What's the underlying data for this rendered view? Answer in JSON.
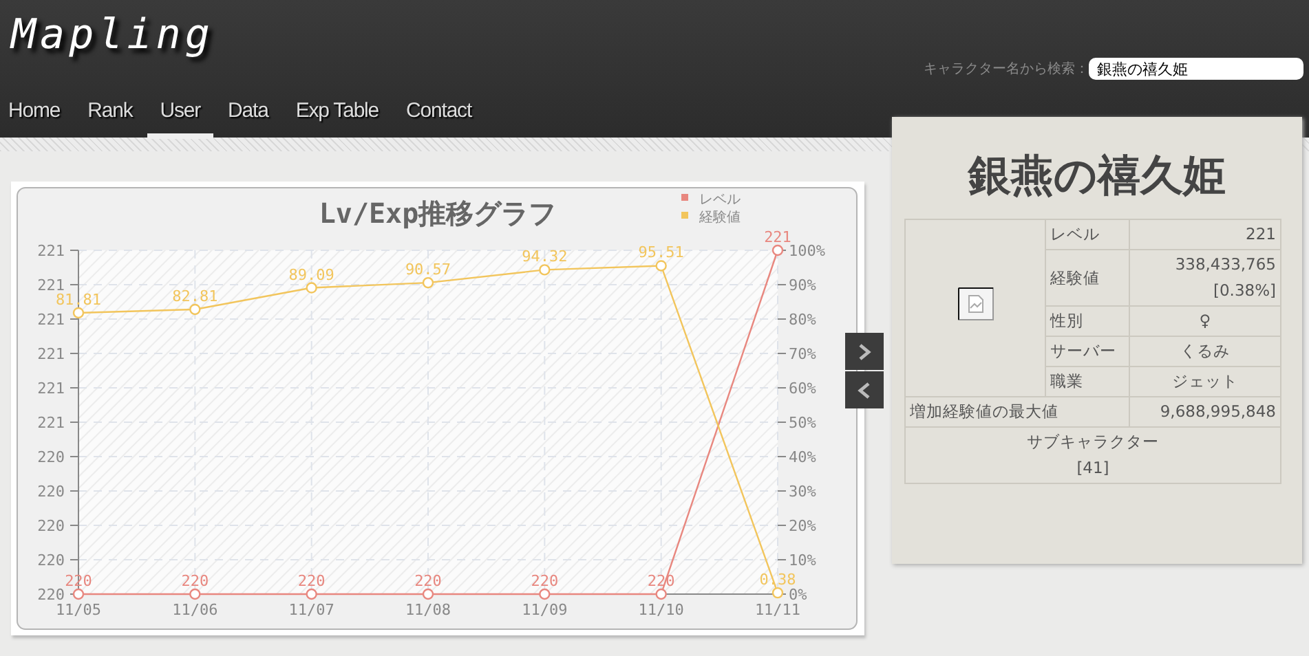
{
  "site": {
    "logo": "Mapling"
  },
  "nav": [
    {
      "label": "Home",
      "selected": false
    },
    {
      "label": "Rank",
      "selected": false
    },
    {
      "label": "User",
      "selected": true
    },
    {
      "label": "Data",
      "selected": false
    },
    {
      "label": "Exp Table",
      "selected": false
    },
    {
      "label": "Contact",
      "selected": false
    }
  ],
  "search": {
    "label": "キャラクター名から検索：",
    "value": "銀燕の禧久姫"
  },
  "chart_panel": {
    "chart_data": {
      "type": "line",
      "title": "Lv/Exp推移グラフ",
      "categories": [
        "11/05",
        "11/06",
        "11/07",
        "11/08",
        "11/09",
        "11/10",
        "11/11"
      ],
      "series": [
        {
          "name": "レベル",
          "color": "#e8877f",
          "axis": "y2",
          "marker": "circle",
          "values": [
            220,
            220,
            220,
            220,
            220,
            220,
            221
          ]
        },
        {
          "name": "経験値",
          "color": "#f2c55c",
          "marker": "circle",
          "values": [
            81.81,
            82.81,
            89.09,
            90.57,
            94.32,
            95.51,
            0.38
          ]
        }
      ],
      "ylim": [
        0,
        100
      ],
      "yticks": [
        {
          "value": 0,
          "label": "0%"
        },
        {
          "value": 10,
          "label": "10%"
        },
        {
          "value": 20,
          "label": "20%"
        },
        {
          "value": 30,
          "label": "30%"
        },
        {
          "value": 40,
          "label": "40%"
        },
        {
          "value": 50,
          "label": "50%"
        },
        {
          "value": 60,
          "label": "60%"
        },
        {
          "value": 70,
          "label": "70%"
        },
        {
          "value": 80,
          "label": "80%"
        },
        {
          "value": 90,
          "label": "90%"
        },
        {
          "value": 100,
          "label": "100%"
        }
      ],
      "y2lim": [
        220,
        221
      ],
      "y2ticks": [
        {
          "value": 220,
          "label": "220"
        },
        {
          "value": 220.1,
          "label": "220"
        },
        {
          "value": 220.2,
          "label": "220"
        },
        {
          "value": 220.3,
          "label": "220"
        },
        {
          "value": 220.4,
          "label": "220"
        },
        {
          "value": 220.5,
          "label": "221"
        },
        {
          "value": 220.6,
          "label": "221"
        },
        {
          "value": 220.7,
          "label": "221"
        },
        {
          "value": 220.8,
          "label": "221"
        },
        {
          "value": 220.9,
          "label": "221"
        },
        {
          "value": 221,
          "label": "221"
        }
      ],
      "grid": true,
      "legend": "top-right",
      "data_labels": true
    }
  },
  "character": {
    "name": "銀燕の禧久姫",
    "fields": [
      {
        "label": "レベル",
        "value": "221"
      },
      {
        "label": "経験値",
        "value": "338,433,765",
        "note": "[0.38%]"
      },
      {
        "label": "性別",
        "value": "♀"
      },
      {
        "label": "サーバー",
        "value": "くるみ"
      },
      {
        "label": "職業",
        "value": "ジェット"
      }
    ],
    "max_exp": {
      "label": "増加経験値の最大値",
      "value": "9,688,995,848"
    },
    "sub": {
      "label": "サブキャラクター",
      "count": "[41]"
    }
  }
}
